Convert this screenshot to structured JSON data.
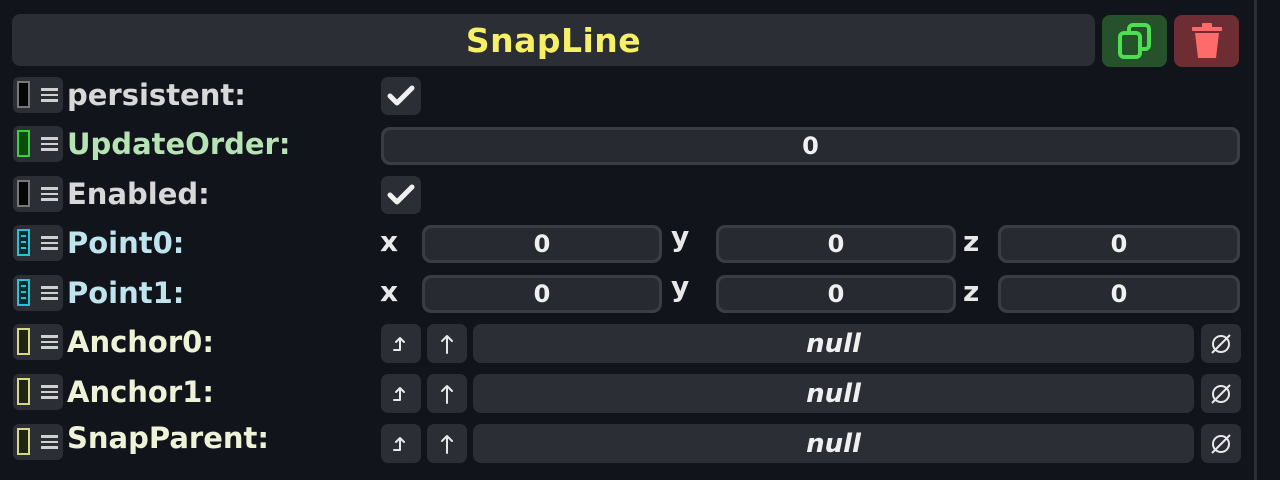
{
  "header": {
    "title": "SnapLine"
  },
  "properties": {
    "persistent": {
      "label": "persistent:"
    },
    "update_order": {
      "label": "UpdateOrder:",
      "value": "0"
    },
    "enabled": {
      "label": "Enabled:"
    },
    "point0": {
      "label": "Point0:",
      "x_label": "x",
      "y_label": "y",
      "z_label": "z",
      "x": "0",
      "y": "0",
      "z": "0"
    },
    "point1": {
      "label": "Point1:",
      "x_label": "x",
      "y_label": "y",
      "z_label": "z",
      "x": "0",
      "y": "0",
      "z": "0"
    },
    "anchor0": {
      "label": "Anchor0:",
      "value": "null"
    },
    "anchor1": {
      "label": "Anchor1:",
      "value": "null"
    },
    "snap_parent": {
      "label": "SnapParent:",
      "value": "null"
    }
  },
  "icons": {
    "duplicate": "duplicate-icon",
    "delete": "trash-icon",
    "check": "checkmark-icon",
    "pick": "pick-icon",
    "up": "arrow-up-icon",
    "clear": "empty-set-icon"
  },
  "colors": {
    "title": "#f5f064",
    "duplicate_bg": "#26522b",
    "delete_bg": "#6e2d33",
    "label_green": "#b5e3b4",
    "label_cyan": "#bfe4ee"
  }
}
